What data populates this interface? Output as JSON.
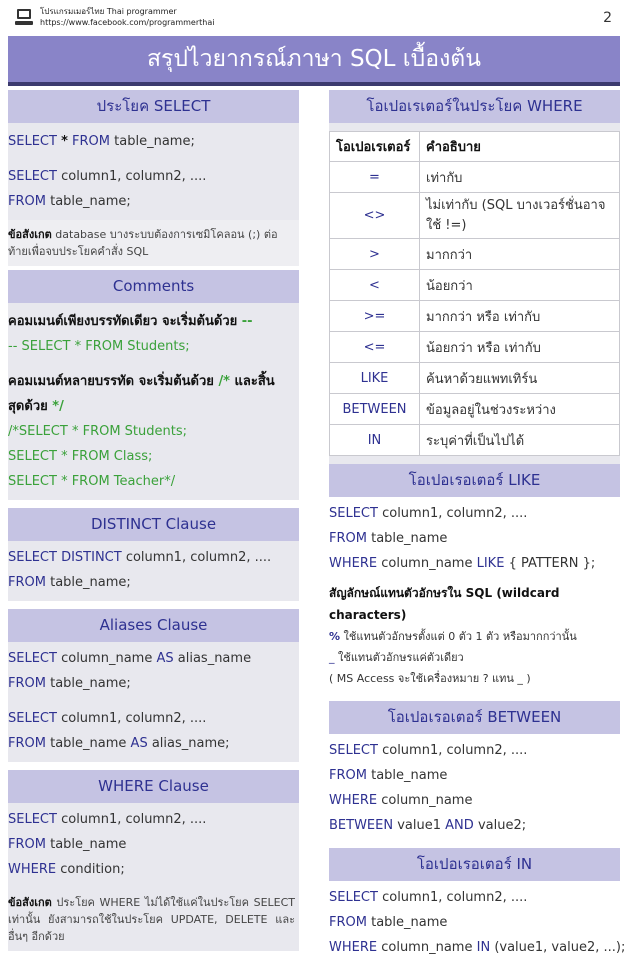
{
  "header": {
    "site_name": "โปรแกรมเมอร์ไทย Thai programmer",
    "url": "https://www.facebook.com/programmerthai",
    "page_number": "2"
  },
  "title": "สรุปไวยากรณ์ภาษา SQL เบื้องต้น",
  "left": {
    "select": {
      "heading": "ประโยค SELECT",
      "l1_kw": "SELECT",
      "l1_star": "*",
      "l1_from": "FROM",
      "l1_rest": "table_name;",
      "l2_kw": "SELECT",
      "l2_rest": "column1, column2, ....",
      "l3_kw": "FROM",
      "l3_rest": "table_name;",
      "note_bold": "ข้อสังเกต",
      "note_text": "database บางระบบต้องการเซมิโคลอน (;) ต่อท้ายเพื่อจบประโยคคำสั่ง SQL"
    },
    "comments": {
      "heading": "Comments",
      "single_label": "คอมเมนต์เพียงบรรทัดเดียว จะเริ่มต้นด้วย",
      "single_mark": "--",
      "single_example": "-- SELECT * FROM Students;",
      "multi_label_1": "คอมเมนต์หลายบรรทัด จะเริ่มต้นด้วย",
      "multi_mark_open": "/*",
      "multi_label_2": "และสิ้น",
      "multi_label_3": "สุดด้วย",
      "multi_mark_close": "*/",
      "multi_ex_1": "/*SELECT * FROM Students;",
      "multi_ex_2": "SELECT * FROM Class;",
      "multi_ex_3": "SELECT * FROM Teacher*/"
    },
    "distinct": {
      "heading": "DISTINCT Clause",
      "l1_kw": "SELECT DISTINCT",
      "l1_rest": "column1, column2, ....",
      "l2_kw": "FROM",
      "l2_rest": "table_name;"
    },
    "aliases": {
      "heading": "Aliases Clause",
      "l1_kw": "SELECT",
      "l1_rest": "column_name",
      "l1_as": "AS",
      "l1_alias": "alias_name",
      "l2_kw": "FROM",
      "l2_rest": "table_name;",
      "l3_kw": "SELECT",
      "l3_rest": "column1, column2, ....",
      "l4_kw": "FROM",
      "l4_rest": "table_name",
      "l4_as": "AS",
      "l4_alias": "alias_name;"
    },
    "where": {
      "heading": "WHERE Clause",
      "l1_kw": "SELECT",
      "l1_rest": "column1, column2, ....",
      "l2_kw": "FROM",
      "l2_rest": "table_name",
      "l3_kw": "WHERE",
      "l3_rest": "condition;",
      "note_bold": "ข้อสังเกต",
      "note_text": "ประโยค WHERE ไม่ได้ใช้แค่ในประโยค SELECT เท่านั้น ยังสามารถใช้ในประโยค UPDATE, DELETE และอื่นๆ อีกด้วย"
    }
  },
  "right": {
    "operators": {
      "heading": "โอเปอเรเตอร์ในประโยค WHERE",
      "col_op": "โอเปอเรเตอร์",
      "col_desc": "คำอธิบาย",
      "rows": [
        {
          "op": "=",
          "desc": "เท่ากับ"
        },
        {
          "op": "<>",
          "desc": "ไม่เท่ากับ (SQL บางเวอร์ชั่นอาจใช้ !=)"
        },
        {
          "op": ">",
          "desc": "มากกว่า"
        },
        {
          "op": "<",
          "desc": "น้อยกว่า"
        },
        {
          "op": ">=",
          "desc": "มากกว่า หรือ เท่ากับ"
        },
        {
          "op": "<=",
          "desc": "น้อยกว่า หรือ เท่ากับ"
        },
        {
          "op": "LIKE",
          "desc": "ค้นหาด้วยแพทเทิร์น"
        },
        {
          "op": "BETWEEN",
          "desc": "ข้อมูลอยู่ในช่วงระหว่าง"
        },
        {
          "op": "IN",
          "desc": "ระบุค่าที่เป็นไปได้"
        }
      ]
    },
    "like": {
      "heading": "โอเปอเรอเตอร์ LIKE",
      "l1_kw": "SELECT",
      "l1_rest": "column1, column2, ....",
      "l2_kw": "FROM",
      "l2_rest": "table_name",
      "l3_kw": "WHERE",
      "l3_rest": "column_name",
      "l3_like": "LIKE",
      "l3_tail": "{ PATTERN };",
      "wild_head": "สัญลักษณ์แทนตัวอักษรใน SQL (wildcard characters)",
      "pct": "%",
      "pct_text": "ใช้แทนตัวอักษรตั้งแต่ 0 ตัว 1 ตัว หรือมากกว่านั้น",
      "underscore": "_",
      "underscore_text": "ใช้แทนตัวอักษรแค่ตัวเดียว",
      "msaccess": "( MS Access จะใช้เครื่องหมาย ? แทน _ )"
    },
    "between": {
      "heading": "โอเปอเรอเตอร์ BETWEEN",
      "l1_kw": "SELECT",
      "l1_rest": "column1, column2, ....",
      "l2_kw": "FROM",
      "l2_rest": "table_name",
      "l3_kw": "WHERE",
      "l3_rest": "column_name",
      "l4_kw": "BETWEEN",
      "l4_v1": "value1",
      "l4_and": "AND",
      "l4_v2": "value2;"
    },
    "in": {
      "heading": "โอเปอเรอเตอร์ IN",
      "l1_kw": "SELECT",
      "l1_rest": "column1, column2, ....",
      "l2_kw": "FROM",
      "l2_rest": "table_name",
      "l3_kw": "WHERE",
      "l3_rest": "column_name",
      "l3_in": "IN",
      "l3_tail": "(value1, value2, ...);"
    }
  }
}
